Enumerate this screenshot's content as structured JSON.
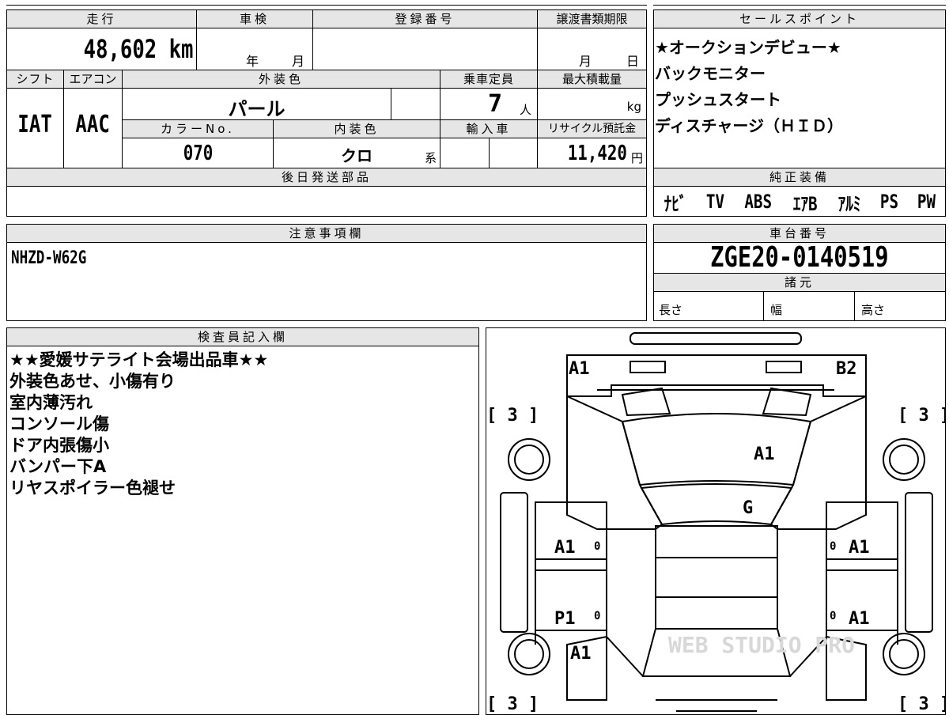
{
  "vehicle": {
    "mileage_header": "走行",
    "mileage": "48,602 km",
    "inspection_header": "車検",
    "inspection_year_label": "年",
    "inspection_month_label": "月",
    "registration_header": "登録番号",
    "registration_value": "",
    "transfer_deadline_header": "譲渡書類期限",
    "transfer_month_label": "月",
    "transfer_day_label": "日",
    "shift_header": "シフト",
    "shift": "IAT",
    "aircon_header": "エアコン",
    "aircon": "AAC",
    "exterior_color_header": "外装色",
    "exterior_color": "パール",
    "capacity_header": "乗車定員",
    "capacity": "7",
    "capacity_unit": "人",
    "max_load_header": "最大積載量",
    "max_load_unit": "kg",
    "color_no_header": "カラーNo.",
    "color_no": "070",
    "interior_color_header": "内装色",
    "interior_color": "クロ",
    "interior_suffix": "系",
    "import_header": "輸入車",
    "recycle_header": "リサイクル預託金",
    "recycle_fee": "11,420",
    "recycle_unit": "円",
    "later_parts_header": "後日発送部品",
    "notes_header": "注意事項欄",
    "notes": "NHZD-W62G",
    "chassis_header": "車台番号",
    "chassis_no": "ZGE20-0140519",
    "specs_header": "諸元",
    "length_label": "長さ",
    "width_label": "幅",
    "height_label": "高さ"
  },
  "sales_points": {
    "header": "セールスポイント",
    "items": [
      "★オークションデビュー★",
      "バックモニター",
      "プッシュスタート",
      "ディスチャージ（ＨＩＤ）"
    ]
  },
  "equipment": {
    "header": "純正装備",
    "items": [
      "ﾅﾋﾞ",
      "TV",
      "ABS",
      "ｴｱB",
      "ｱﾙﾐ",
      "PS",
      "PW"
    ]
  },
  "inspector": {
    "header": "検査員記入欄",
    "lines": [
      "★★愛媛サテライト会場出品車★★",
      "外装色あせ、小傷有り",
      "室内薄汚れ",
      "コンソール傷",
      "ドア内張傷小",
      "バンパー下A",
      "リヤスポイラー色褪せ"
    ]
  },
  "diagram": {
    "marks": {
      "front_left": "A1",
      "front_right": "B2",
      "hood": "A1",
      "windshield": "G",
      "left_front_door": "A1",
      "left_rear_door": "P1",
      "left_rear_fender": "A1",
      "right_front_door": "A1",
      "right_rear_door": "A1"
    },
    "tire_label": "[ 3 ]",
    "small_zero": "0",
    "watermark": "WEB STUDIO PRO"
  }
}
